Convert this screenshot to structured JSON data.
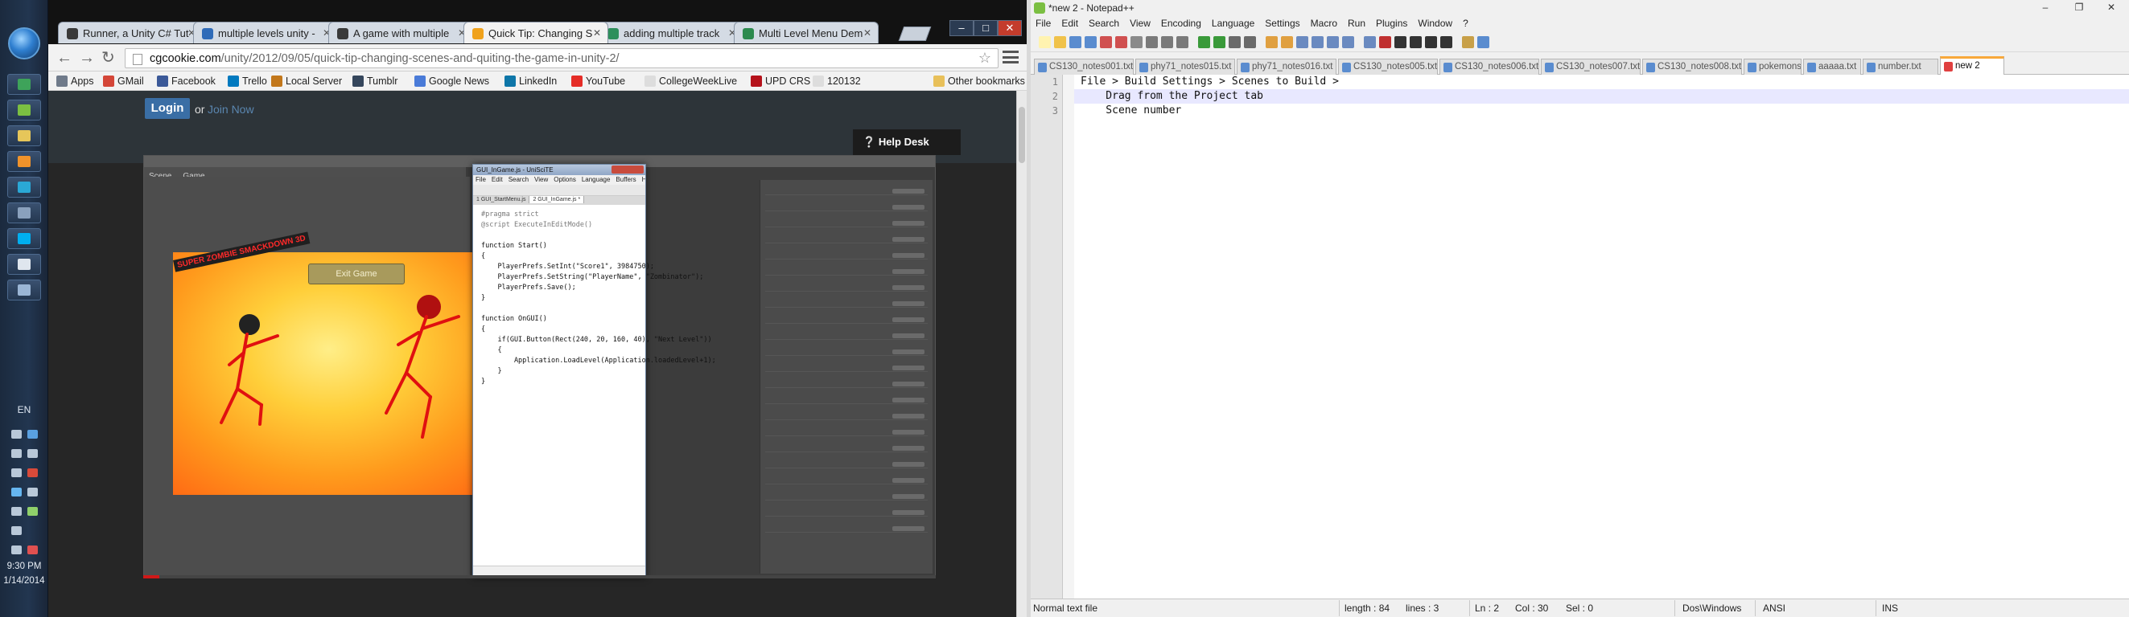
{
  "browser": {
    "tabs": [
      {
        "label": "Runner, a Unity C# Tut",
        "color": "#3a3a3a"
      },
      {
        "label": "multiple levels unity -",
        "color": "#2f6bb8"
      },
      {
        "label": "A game with multiple",
        "color": "#3a3a3a"
      },
      {
        "label": "Quick Tip: Changing S",
        "color": "#f0a21c"
      },
      {
        "label": "adding multiple track",
        "color": "#2e8f5c"
      },
      {
        "label": "Multi Level Menu Dem",
        "color": "#2c8a4e"
      }
    ],
    "active_tab": 3,
    "url_domain": "cgcookie.com",
    "url_path": "/unity/2012/09/05/quick-tip-changing-scenes-and-quiting-the-game-in-unity-2/",
    "bookmarks": [
      {
        "label": "Apps",
        "color": "#6f7a8a"
      },
      {
        "label": "GMail",
        "color": "#d44638"
      },
      {
        "label": "Facebook",
        "color": "#3b5998"
      },
      {
        "label": "Trello",
        "color": "#0079bf"
      },
      {
        "label": "Local Server",
        "color": "#c2771b"
      },
      {
        "label": "Tumblr",
        "color": "#35465c"
      },
      {
        "label": "Google News",
        "color": "#4a7bd8"
      },
      {
        "label": "LinkedIn",
        "color": "#0e76a8"
      },
      {
        "label": "YouTube",
        "color": "#e52d27"
      },
      {
        "label": "CollegeWeekLive",
        "color": "#dddddd"
      },
      {
        "label": "UPD CRS",
        "color": "#b5121b"
      },
      {
        "label": "120132",
        "color": "#dddddd"
      }
    ],
    "other_bookmarks": "Other bookmarks",
    "site": {
      "login": "Login",
      "or": "or",
      "join": "Join Now",
      "help_desk": "Help Desk"
    },
    "video_progress": 0.02
  },
  "unity": {
    "exit_button": "Exit Game",
    "game_title": "SUPER ZOMBIE SMACKDOWN 3D",
    "editor_title": "GUI_InGame.js - UniSciTE",
    "editor_menu": [
      "File",
      "Edit",
      "Search",
      "View",
      "Options",
      "Language",
      "Buffers",
      "Help"
    ],
    "editor_tabs": [
      "1 GUI_StartMenu.js",
      "2 GUI_InGame.js *"
    ],
    "code_lines": [
      "#pragma strict",
      "@script ExecuteInEditMode()",
      "",
      "function Start()",
      "{",
      "    PlayerPrefs.SetInt(\"Score1\", 3984750);",
      "    PlayerPrefs.SetString(\"PlayerName\", \"Zombinator\");",
      "    PlayerPrefs.Save();",
      "}",
      "",
      "function OnGUI()",
      "{",
      "    if(GUI.Button(Rect(240, 20, 160, 40), \"Next Level\"))",
      "    {",
      "        Application.LoadLevel(Application.loadedLevel+1);",
      "    }",
      "}"
    ]
  },
  "taskbar": {
    "lang": "EN",
    "time": "9:30 PM",
    "date": "1/14/2014"
  },
  "notepad": {
    "title": "*new  2 - Notepad++",
    "menu": [
      "File",
      "Edit",
      "Search",
      "View",
      "Encoding",
      "Language",
      "Settings",
      "Macro",
      "Run",
      "Plugins",
      "Window",
      "?"
    ],
    "tabs": [
      "CS130_notes001.txt",
      "phy71_notes015.txt",
      "phy71_notes016.txt",
      "CS130_notes005.txt",
      "CS130_notes006.txt",
      "CS130_notes007.txt",
      "CS130_notes008.txt",
      "pokemons.txt",
      "aaaaa.txt",
      "number.txt",
      "new  2"
    ],
    "active_tab": 10,
    "lines": [
      "File > Build Settings > Scenes to Build >",
      "    Drag from the Project tab",
      "    Scene number"
    ],
    "current_line": 1,
    "line_numbers": [
      "1",
      "2",
      "3"
    ],
    "status": {
      "type": "Normal text file",
      "length": "length : 84",
      "lines": "lines : 3",
      "ln": "Ln : 2",
      "col": "Col : 30",
      "sel": "Sel : 0",
      "eol": "Dos\\Windows",
      "enc": "ANSI",
      "ins": "INS"
    }
  }
}
